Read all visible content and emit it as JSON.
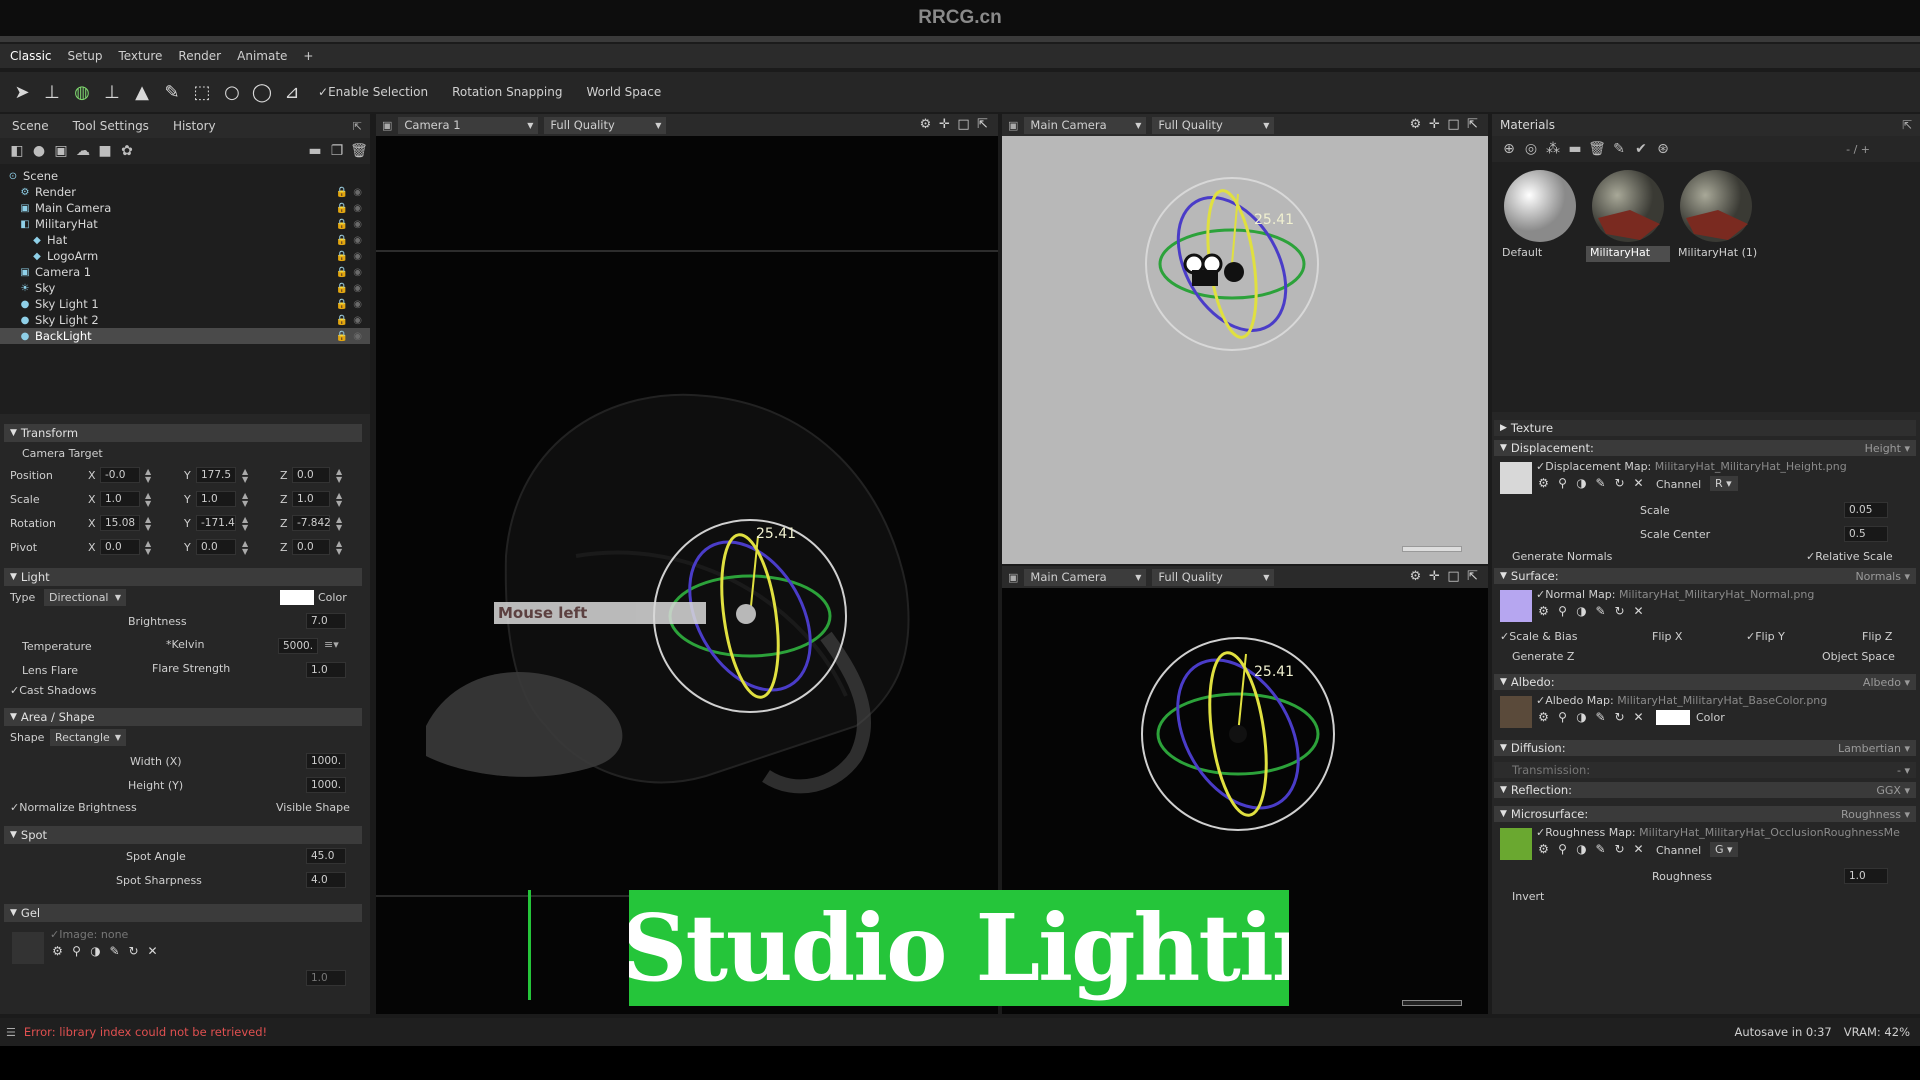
{
  "window": {
    "title": "RRCG.cn"
  },
  "menu": [
    "Classic",
    "Setup",
    "Texture",
    "Render",
    "Animate",
    "+"
  ],
  "toolbar": {
    "icons": [
      "select-arrow-icon",
      "transform-icon",
      "rotate-gizmo-icon",
      "scale-icon",
      "mesh-icon",
      "paint-icon",
      "rect-select-icon",
      "circle-select-icon",
      "lasso-icon",
      "poly-lasso-icon"
    ],
    "enable_selection": "Enable Selection",
    "rotation_snapping": "Rotation Snapping",
    "world_space": "World Space"
  },
  "left_tabs": [
    "Scene",
    "Tool Settings",
    "History"
  ],
  "scene_tree": [
    {
      "label": "Scene",
      "icon": "scene-icon",
      "depth": 0
    },
    {
      "label": "Render",
      "icon": "gear-icon",
      "depth": 1
    },
    {
      "label": "Main Camera",
      "icon": "camera-icon",
      "depth": 1
    },
    {
      "label": "MilitaryHat",
      "icon": "object-icon",
      "depth": 1
    },
    {
      "label": "Hat",
      "icon": "mesh-icon",
      "depth": 2
    },
    {
      "label": "LogoArm",
      "icon": "mesh-icon",
      "depth": 2
    },
    {
      "label": "Camera 1",
      "icon": "camera-icon",
      "depth": 1
    },
    {
      "label": "Sky",
      "icon": "sky-icon",
      "depth": 1
    },
    {
      "label": "Sky Light 1",
      "icon": "light-icon",
      "depth": 1
    },
    {
      "label": "Sky Light 2",
      "icon": "light-icon",
      "depth": 1
    },
    {
      "label": "BackLight",
      "icon": "light-icon",
      "depth": 1,
      "selected": true
    }
  ],
  "transform": {
    "title": "Transform",
    "camera_target": "Camera Target",
    "position": {
      "label": "Position",
      "x": "-0.0",
      "y": "177.5",
      "z": "0.0"
    },
    "scale": {
      "label": "Scale",
      "x": "1.0",
      "y": "1.0",
      "z": "1.0"
    },
    "rotation": {
      "label": "Rotation",
      "x": "15.08",
      "y": "-171.4",
      "z": "-7.842"
    },
    "pivot": {
      "label": "Pivot",
      "x": "0.0",
      "y": "0.0",
      "z": "0.0"
    },
    "axis_x": "X",
    "axis_y": "Y",
    "axis_z": "Z"
  },
  "light": {
    "title": "Light",
    "type_label": "Type",
    "type_value": "Directional",
    "color_label": "Color",
    "brightness_label": "Brightness",
    "brightness": "7.0",
    "temperature_label": "Temperature",
    "kelvin_label": "*Kelvin",
    "temperature": "5000.",
    "lens_flare_label": "Lens Flare",
    "flare_strength_label": "Flare Strength",
    "flare_strength": "1.0",
    "cast_shadows": "Cast Shadows"
  },
  "area": {
    "title": "Area / Shape",
    "shape_label": "Shape",
    "shape_value": "Rectangle",
    "width_label": "Width (X)",
    "width": "1000.",
    "height_label": "Height (Y)",
    "height": "1000.",
    "normalize": "Normalize Brightness",
    "visible_shape": "Visible Shape"
  },
  "spot": {
    "title": "Spot",
    "angle_label": "Spot Angle",
    "angle": "45.0",
    "sharpness_label": "Spot Sharpness",
    "sharpness": "4.0"
  },
  "gel": {
    "title": "Gel",
    "image": "Image: none",
    "value": "1.0"
  },
  "viewport_left": {
    "camera": "Camera 1",
    "quality": "Full Quality",
    "gizmo_value": "25.41",
    "tooltip": "Mouse left"
  },
  "viewport_top_right": {
    "camera": "Main Camera",
    "quality": "Full Quality",
    "gizmo_value": "25.41"
  },
  "viewport_bottom_right": {
    "camera": "Main Camera",
    "quality": "Full Quality",
    "gizmo_value": "25.41"
  },
  "banner": {
    "text": "Studio Lighting"
  },
  "materials": {
    "title": "Materials",
    "counter": "- / +",
    "items": [
      {
        "label": "Default",
        "selected": false
      },
      {
        "label": "MilitaryHat",
        "selected": true
      },
      {
        "label": "MilitaryHat (1)",
        "selected": false
      }
    ]
  },
  "texture_section": "Texture",
  "displacement": {
    "title": "Displacement:",
    "mode": "Height",
    "map_label": "Displacement Map:",
    "map_file": "MilitaryHat_MilitaryHat_Height.png",
    "channel_label": "Channel",
    "channel": "R",
    "scale_label": "Scale",
    "scale": "0.05",
    "scale_center_label": "Scale Center",
    "scale_center": "0.5",
    "generate_normals": "Generate Normals",
    "relative_scale": "Relative Scale"
  },
  "surface": {
    "title": "Surface:",
    "mode": "Normals",
    "map_label": "Normal Map:",
    "map_file": "MilitaryHat_MilitaryHat_Normal.png",
    "scale_bias": "Scale & Bias",
    "flip_x": "Flip X",
    "flip_y": "Flip Y",
    "flip_z": "Flip Z",
    "generate_z": "Generate Z",
    "object_space": "Object Space"
  },
  "albedo": {
    "title": "Albedo:",
    "mode": "Albedo",
    "map_label": "Albedo Map:",
    "map_file": "MilitaryHat_MilitaryHat_BaseColor.png",
    "color_label": "Color"
  },
  "diffusion": {
    "title": "Diffusion:",
    "mode": "Lambertian"
  },
  "transmission": {
    "title": "Transmission:",
    "mode": "-"
  },
  "reflection": {
    "title": "Reflection:",
    "mode": "GGX"
  },
  "microsurface": {
    "title": "Microsurface:",
    "mode": "Roughness",
    "map_label": "Roughness Map:",
    "map_file": "MilitaryHat_MilitaryHat_OcclusionRoughnessMe",
    "channel_label": "Channel",
    "channel": "G",
    "roughness_label": "Roughness",
    "roughness": "1.0",
    "invert": "Invert"
  },
  "status": {
    "error": "Error: library index could not be retrieved!",
    "autosave": "Autosave in 0:37",
    "vram": "VRAM: 42%"
  },
  "colors": {
    "accent_green": "#25c53a",
    "error_red": "#e05050",
    "panel": "#262626"
  }
}
